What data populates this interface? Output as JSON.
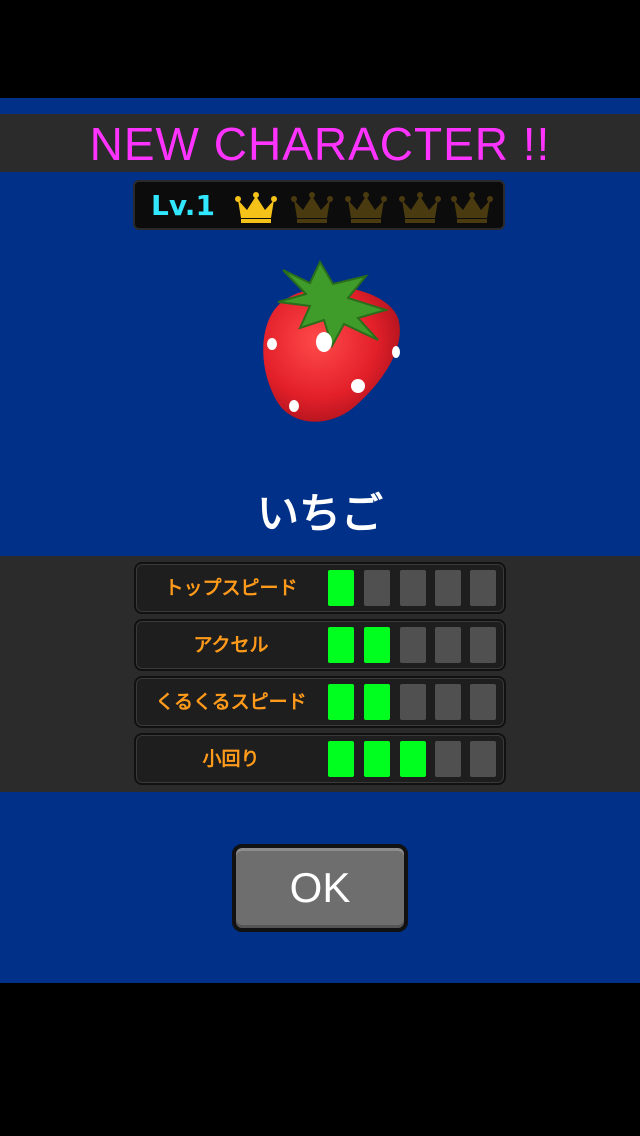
{
  "title": "NEW CHARACTER !!",
  "level": {
    "label": "Lv.1",
    "crowns_total": 5,
    "crowns_earned": 1,
    "crown_colors": {
      "earned": "#f5c21a",
      "empty": "#4a3a10"
    }
  },
  "character": {
    "name": "いちご",
    "image_icon": "strawberry-icon"
  },
  "stats": [
    {
      "label": "トップスピード",
      "value": 1,
      "max": 5
    },
    {
      "label": "アクセル",
      "value": 2,
      "max": 5
    },
    {
      "label": "くるくるスピード",
      "value": 2,
      "max": 5
    },
    {
      "label": "小回り",
      "value": 3,
      "max": 5
    }
  ],
  "ok_button": {
    "label": "OK"
  },
  "colors": {
    "panel": "#003087",
    "title": "#ff33ff",
    "level_text": "#31e6ff",
    "stat_label": "#ff9a1a",
    "bar_on": "#00ff1e",
    "bar_off": "#505050"
  }
}
